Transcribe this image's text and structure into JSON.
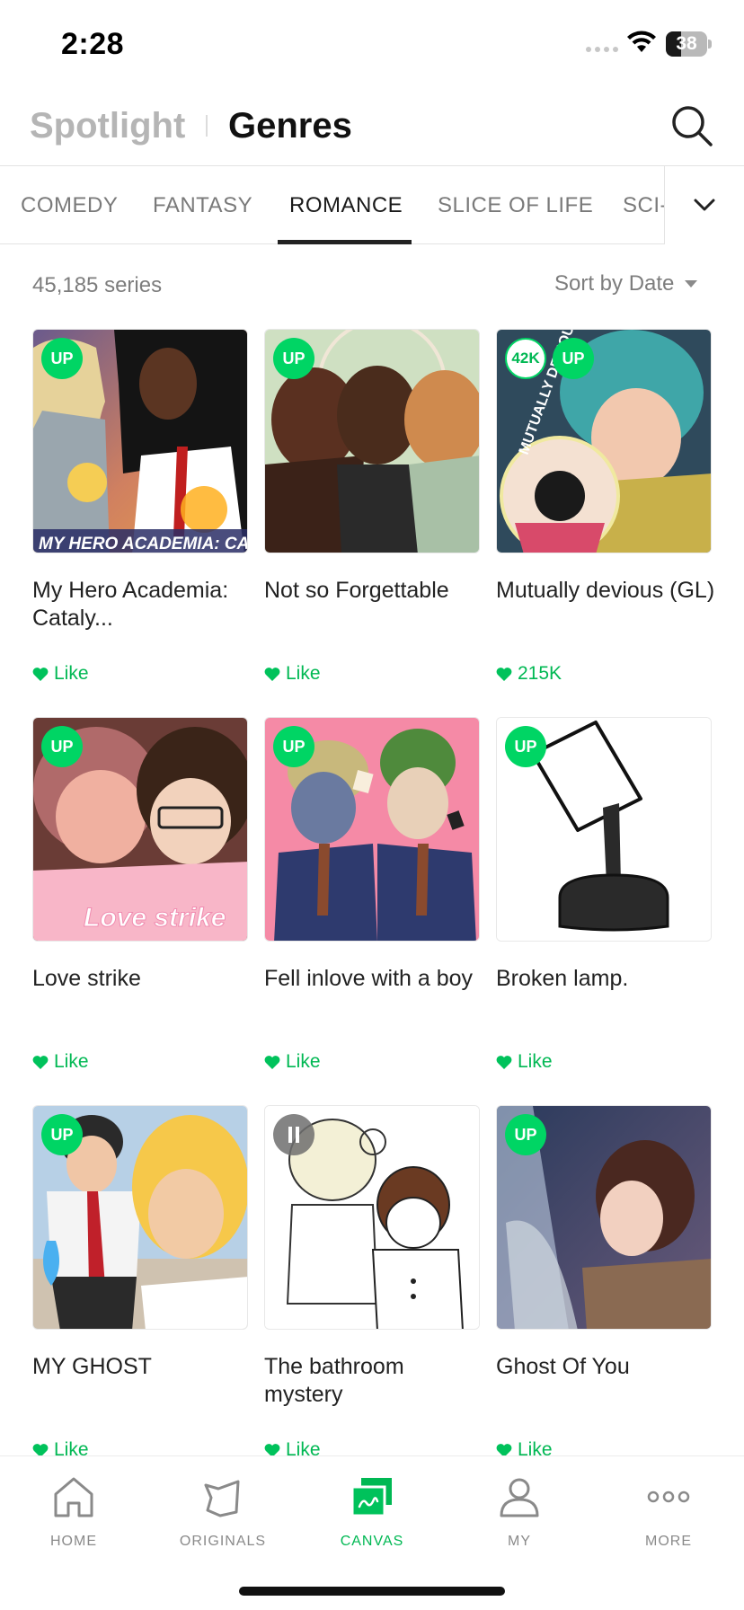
{
  "status_bar": {
    "time": "2:28",
    "battery": "38"
  },
  "header": {
    "tab_spotlight": "Spotlight",
    "tab_genres": "Genres"
  },
  "genres": {
    "tabs": [
      "COMEDY",
      "FANTASY",
      "ROMANCE",
      "SLICE OF LIFE",
      "SCI-"
    ],
    "active": "ROMANCE"
  },
  "list": {
    "count": "45,185 series",
    "sort_label": "Sort by Date"
  },
  "series": [
    {
      "title": "My Hero Academia: Cataly...",
      "like": "Like",
      "badge": "UP",
      "thumb_caption": "MY HERO ACADEMIA: CATALYST"
    },
    {
      "title": "Not so Forgettable",
      "like": "Like",
      "badge": "UP"
    },
    {
      "title": "Mutually devious (GL)",
      "like": "215K",
      "badge": "UP",
      "views_badge": "42K",
      "thumb_caption": "MUTUALLY DEVIOUS"
    },
    {
      "title": "Love strike",
      "like": "Like",
      "badge": "UP",
      "thumb_caption": "Love strike"
    },
    {
      "title": "Fell inlove with a boy",
      "like": "Like",
      "badge": "UP"
    },
    {
      "title": "Broken lamp.",
      "like": "Like",
      "badge": "UP"
    },
    {
      "title": "MY GHOST",
      "like": "Like",
      "badge": "UP"
    },
    {
      "title": "The bathroom mystery",
      "like": "Like",
      "badge": "pause"
    },
    {
      "title": "Ghost Of You",
      "like": "Like",
      "badge": "UP"
    }
  ],
  "bottom_nav": [
    {
      "label": "HOME",
      "icon": "home-icon"
    },
    {
      "label": "ORIGINALS",
      "icon": "originals-icon"
    },
    {
      "label": "CANVAS",
      "icon": "canvas-icon",
      "active": true
    },
    {
      "label": "MY",
      "icon": "person-icon"
    },
    {
      "label": "MORE",
      "icon": "more-dots-icon"
    }
  ],
  "colors": {
    "accent": "#00d564",
    "accent_text": "#00b853"
  }
}
